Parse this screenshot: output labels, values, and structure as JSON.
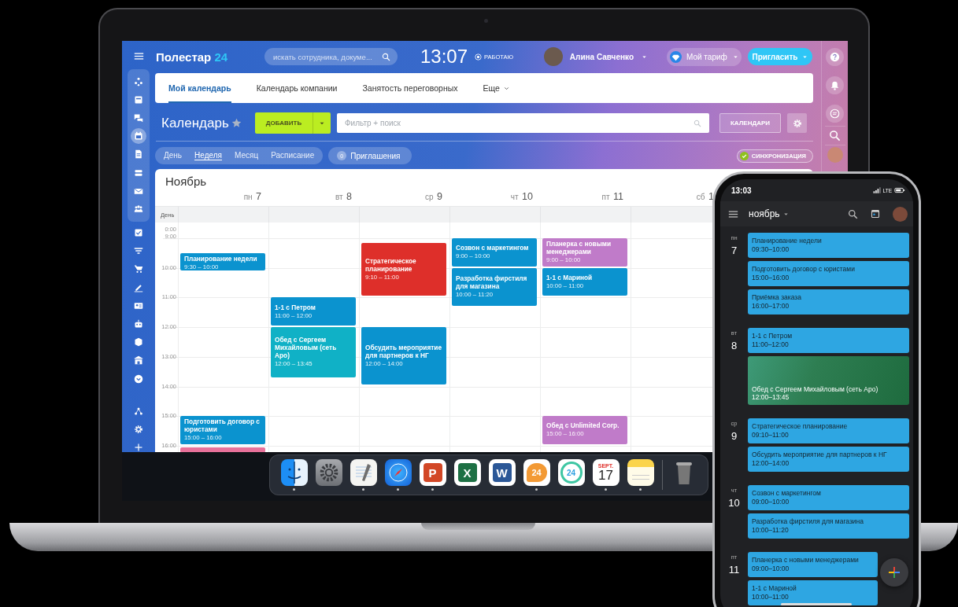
{
  "laptop": {
    "left_rail": {
      "pinned": [
        {
          "kind": "network",
          "selected": false
        },
        {
          "kind": "news",
          "selected": false
        },
        {
          "kind": "chat",
          "selected": false
        },
        {
          "kind": "calendar",
          "selected": true
        },
        {
          "kind": "document",
          "selected": false
        },
        {
          "kind": "drive",
          "selected": false
        },
        {
          "kind": "mail",
          "selected": false
        },
        {
          "kind": "people",
          "selected": false
        }
      ],
      "more": [
        {
          "kind": "task",
          "selected": false
        },
        {
          "kind": "funnel",
          "selected": false
        },
        {
          "kind": "cart",
          "selected": false
        },
        {
          "kind": "pen",
          "selected": false
        },
        {
          "kind": "contact",
          "selected": false
        },
        {
          "kind": "robot",
          "selected": false
        },
        {
          "kind": "box",
          "selected": false
        },
        {
          "kind": "building",
          "selected": false
        },
        {
          "kind": "chevron",
          "selected": false
        }
      ],
      "footer": [
        {
          "kind": "sitemap",
          "selected": false
        },
        {
          "kind": "gear",
          "selected": false
        },
        {
          "kind": "plus",
          "selected": false
        }
      ]
    },
    "topbar": {
      "logo_name": "Полестар",
      "logo_number": "24",
      "search": {
        "placeholder": "искать сотрудника, докуме..."
      },
      "clock": "13:07",
      "status": "РАБОТАЮ",
      "user": "Алина Савченко",
      "plan": "Мой тариф",
      "invite": "Пригласить"
    },
    "right_rail": [
      {
        "kind": "help"
      },
      {
        "kind": "bell"
      },
      {
        "kind": "chatlines"
      },
      {
        "kind": "search"
      },
      {
        "kind": "avatar"
      }
    ],
    "tabs": [
      {
        "kind": "tab",
        "label": "Мой календарь",
        "selected": true
      },
      {
        "kind": "tab",
        "label": "Календарь компании",
        "selected": false
      },
      {
        "kind": "tab",
        "label": "Занятость переговорных",
        "selected": false
      },
      {
        "kind": "menu",
        "label": "Еще",
        "selected": false
      }
    ],
    "toolbar": {
      "title": "Календарь",
      "add_button": "ДОБАВИТЬ",
      "filter": {
        "placeholder": "Фильтр + поиск"
      },
      "calendars_button": "КАЛЕНДАРИ"
    },
    "views": [
      {
        "label": "День",
        "selected": false
      },
      {
        "label": "Неделя",
        "selected": true
      },
      {
        "label": "Месяц",
        "selected": false
      },
      {
        "label": "Расписание",
        "selected": false
      }
    ],
    "invitations": {
      "count": "0",
      "label": "Приглашения"
    },
    "sync": {
      "label": "СИНХРОНИЗАЦИЯ",
      "on": true
    },
    "calendar": {
      "month": "Ноябрь",
      "all_day_label": "День",
      "collapsed_hours": [
        "0:00",
        "9:00"
      ],
      "hours": [
        "10:00",
        "11:00",
        "12:00",
        "13:00",
        "14:00",
        "15:00",
        "16:00"
      ],
      "days": [
        {
          "weekday": "пн",
          "date": "7",
          "events": [
            {
              "title": "Планирование недели",
              "time": "9:30 – 10:00",
              "color": "#0b93cf"
            },
            {
              "title": "Подготовить договор с юристами",
              "time": "15:00 – 16:00",
              "color": "#0b93cf"
            },
            {
              "color": "#e8719a"
            }
          ]
        },
        {
          "weekday": "вт",
          "date": "8",
          "events": [
            {
              "title": "1-1 с Петром",
              "time": "11:00 – 12:00",
              "color": "#0b93cf"
            },
            {
              "title": "Обед с Сергеем Михайловым (сеть Аро)",
              "time": "12:00 – 13:45",
              "color": "#10b1c6"
            }
          ]
        },
        {
          "weekday": "ср",
          "date": "9",
          "events": [
            {
              "title": "Стратегическое планирование",
              "time": "9:10 – 11:00",
              "color": "#de2f2a"
            },
            {
              "title": "Обсудить мероприятие для партнеров к НГ",
              "time": "12:00 – 14:00",
              "color": "#0b93cf"
            }
          ]
        },
        {
          "weekday": "чт",
          "date": "10",
          "events": [
            {
              "title": "Созвон с маркетингом",
              "time": "9:00 – 10:00",
              "color": "#0b93cf"
            },
            {
              "title": "Разработка фирстиля для магазина",
              "time": "10:00 – 11:20",
              "color": "#0b93cf"
            }
          ]
        },
        {
          "weekday": "пт",
          "date": "11",
          "events": [
            {
              "title": "Планерка с новыми менеджерами",
              "time": "9:00 – 10:00",
              "color": "#c07bc9"
            },
            {
              "title": "1-1 с Мариной",
              "time": "10:00 – 11:00",
              "color": "#0b93cf"
            },
            {
              "title": "Обед с Unlimited Corp.",
              "time": "15:00 – 16:00",
              "color": "#c07bc9"
            }
          ]
        },
        {
          "weekday": "сб",
          "date": "1"
        }
      ]
    },
    "dock": [
      {
        "kind": "finder",
        "running": true
      },
      {
        "kind": "settings",
        "running": false
      },
      {
        "kind": "textedit",
        "running": true
      },
      {
        "kind": "safari",
        "running": true
      },
      {
        "kind": "letter",
        "label": "P",
        "color": "#d24726",
        "running": true
      },
      {
        "kind": "letter",
        "label": "X",
        "color": "#1d7044",
        "running": false
      },
      {
        "kind": "letter",
        "label": "W",
        "color": "#2b5797",
        "running": false
      },
      {
        "kind": "bubble",
        "label": "24",
        "running": true
      },
      {
        "kind": "ring",
        "label": "24",
        "running": false
      },
      {
        "kind": "calendar",
        "month": "SEPT.",
        "day": "17",
        "running": true
      },
      {
        "kind": "notes",
        "running": true
      },
      {
        "kind": "trash",
        "running": false
      }
    ]
  },
  "phone": {
    "status": {
      "time": "13:03",
      "network": "LTE"
    },
    "appbar": {
      "month": "ноябрь"
    },
    "days": [
      {
        "weekday": "пн",
        "date": "7",
        "events": [
          {
            "kind": "plain",
            "title": "Планирование недели",
            "time": "09:30–10:00"
          },
          {
            "kind": "plain",
            "title": "Подготовить договор с юристами",
            "time": "15:00–16:00"
          },
          {
            "kind": "plain",
            "title": "Приёмка заказа",
            "time": "16:00–17:00"
          }
        ]
      },
      {
        "weekday": "вт",
        "date": "8",
        "events": [
          {
            "kind": "plain",
            "title": "1-1 с Петром",
            "time": "11:00–12:00"
          },
          {
            "kind": "photo",
            "title": "Обед с Сергеем Михайловым (сеть Аро)",
            "time": "12:00–13:45"
          }
        ]
      },
      {
        "weekday": "ср",
        "date": "9",
        "events": [
          {
            "kind": "plain",
            "title": "Стратегическое планирование",
            "time": "09:10–11:00"
          },
          {
            "kind": "plain",
            "title": "Обсудить мероприятие для партнеров к НГ",
            "time": "12:00–14:00"
          }
        ]
      },
      {
        "weekday": "чт",
        "date": "10",
        "events": [
          {
            "kind": "plain",
            "title": "Созвон с маркетингом",
            "time": "09:00–10:00"
          },
          {
            "kind": "plain",
            "title": "Разработка фирстиля для магазина",
            "time": "10:00–11:20"
          }
        ]
      },
      {
        "weekday": "пт",
        "date": "11",
        "events": [
          {
            "kind": "plain",
            "title": "Планерка с новыми менеджерами",
            "time": "09:00–10:00"
          },
          {
            "kind": "plain",
            "title": "1-1 с Мариной",
            "time": "10:00–11:00"
          }
        ]
      }
    ]
  }
}
